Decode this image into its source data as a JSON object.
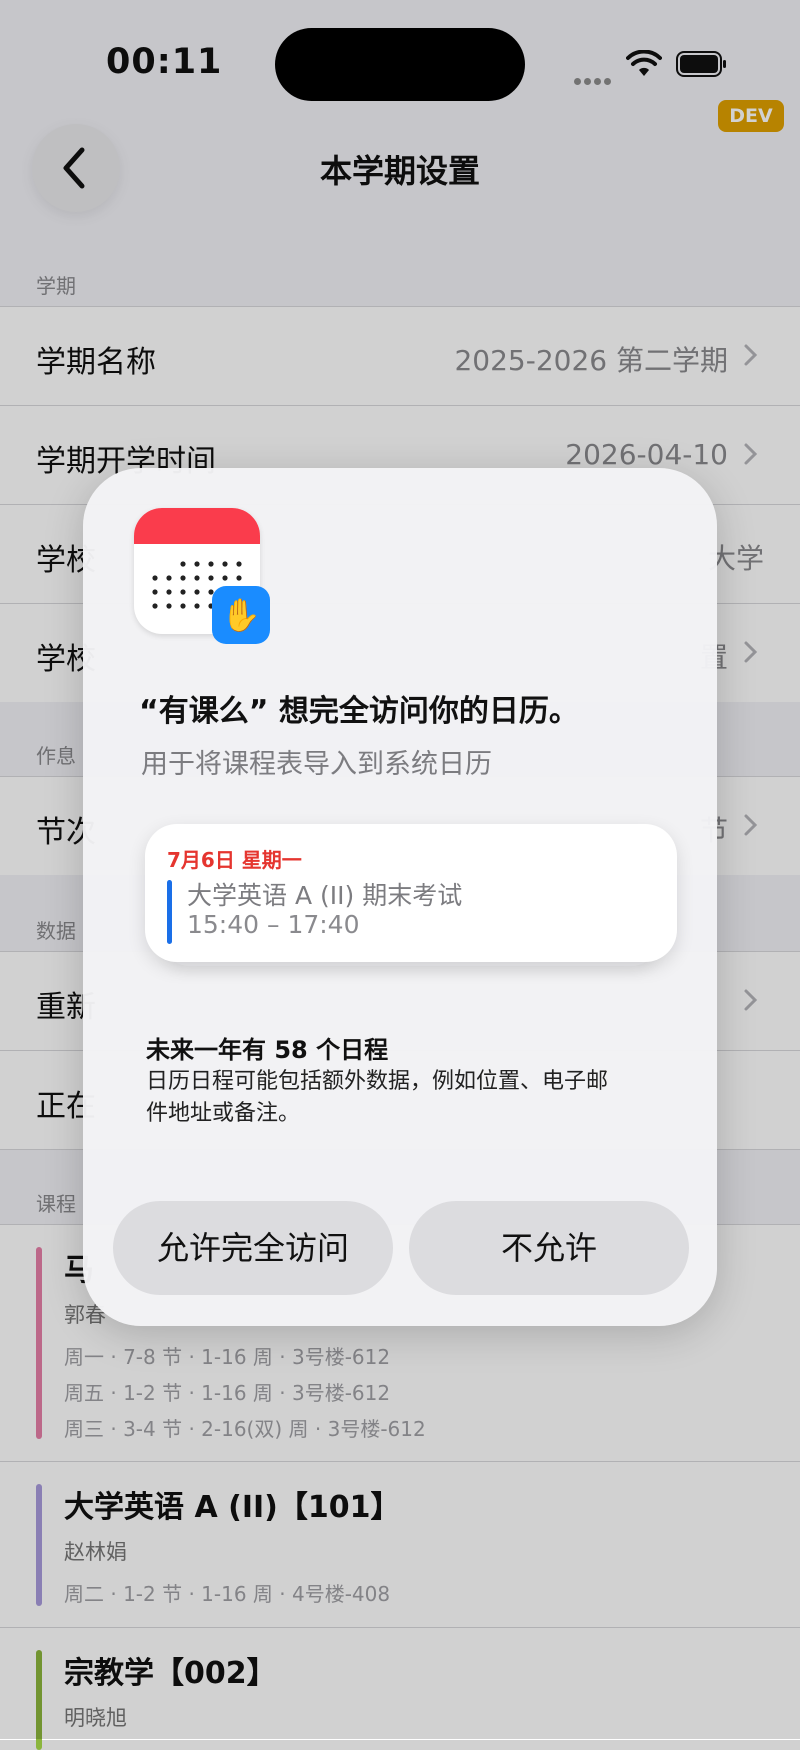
{
  "status_bar": {
    "time": "00:11",
    "dev_badge": "DEV"
  },
  "nav": {
    "title": "本学期设置"
  },
  "sections": {
    "semester": "学期",
    "schedule": "作息",
    "data": "数据",
    "courses": "课程"
  },
  "rows": {
    "semester_name": {
      "label": "学期名称",
      "value": "2025-2026 第二学期"
    },
    "start_date": {
      "label": "学期开学时间",
      "value": "2026-04-10"
    },
    "school": {
      "label": "学校",
      "value": "大学"
    },
    "school2": {
      "label": "学校",
      "value": "置"
    },
    "periods": {
      "label": "节次",
      "value": "节"
    },
    "reimport": {
      "label": "重新"
    },
    "current": {
      "label": "正在"
    }
  },
  "courses": [
    {
      "name": "马",
      "teacher": "郭春",
      "color": "#e67fa8",
      "slots": [
        "周一 · 7-8 节 · 1-16 周 · 3号楼-612",
        "周五 · 1-2 节 · 1-16 周 · 3号楼-612",
        "周三 · 3-4 节 · 2-16(双) 周 · 3号楼-612"
      ]
    },
    {
      "name": "大学英语 A (II)【101】",
      "teacher": "赵林娟",
      "color": "#a99cdc",
      "slots": [
        "周二 · 1-2 节 · 1-16 周 · 4号楼-408"
      ]
    },
    {
      "name": "宗教学【002】",
      "teacher": "明晓旭",
      "color": "#8bb53c",
      "slots": []
    }
  ],
  "dialog": {
    "title": "“有课么” 想完全访问你的日历。",
    "subtitle": "用于将课程表导入到系统日历",
    "preview": {
      "date": "7月6日 星期一",
      "event_name": "大学英语 A (II) 期末考试",
      "event_time": "15:40 – 17:40"
    },
    "count_line": "未来一年有 58 个日程",
    "description": "日历日程可能包括额外数据，例如位置、电子邮件地址或备注。",
    "allow_button": "允许完全访问",
    "deny_button": "不允许"
  },
  "icons": {
    "back": "chevron-left-icon",
    "calendar": "calendar-app-icon",
    "privacy": "hand-raised-icon"
  }
}
